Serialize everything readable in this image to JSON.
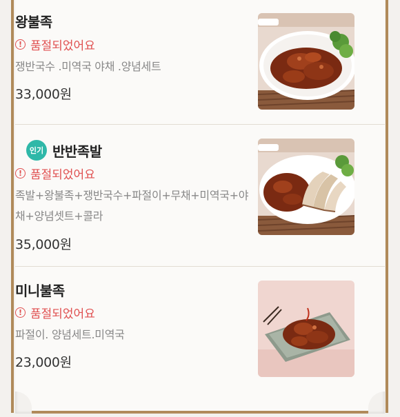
{
  "menu": {
    "items": [
      {
        "name": "왕불족",
        "badge": "",
        "status": "품절되었어요",
        "description": "쟁반국수 .미역국 야채 .양념세트",
        "price": "33,000원",
        "image": "spicy-pork-trotter-dish"
      },
      {
        "name": "반반족발",
        "badge": "인기",
        "status": "품절되었어요",
        "description": "족발+왕불족+쟁반국수+파절이+무채+미역국+야채+양념셋트+콜라",
        "price": "35,000원",
        "image": "half-and-half-pork-trotter-dish"
      },
      {
        "name": "미니불족",
        "badge": "",
        "status": "품절되었어요",
        "description": "파절이. 양념세트.미역국",
        "price": "23,000원",
        "image": "mini-spicy-pork-trotter-dish"
      }
    ],
    "alert_icon": "exclamation-circle-icon",
    "colors": {
      "soldout": "#e05050",
      "badge": "#2fb8a8",
      "frame": "#b08a5a"
    }
  }
}
